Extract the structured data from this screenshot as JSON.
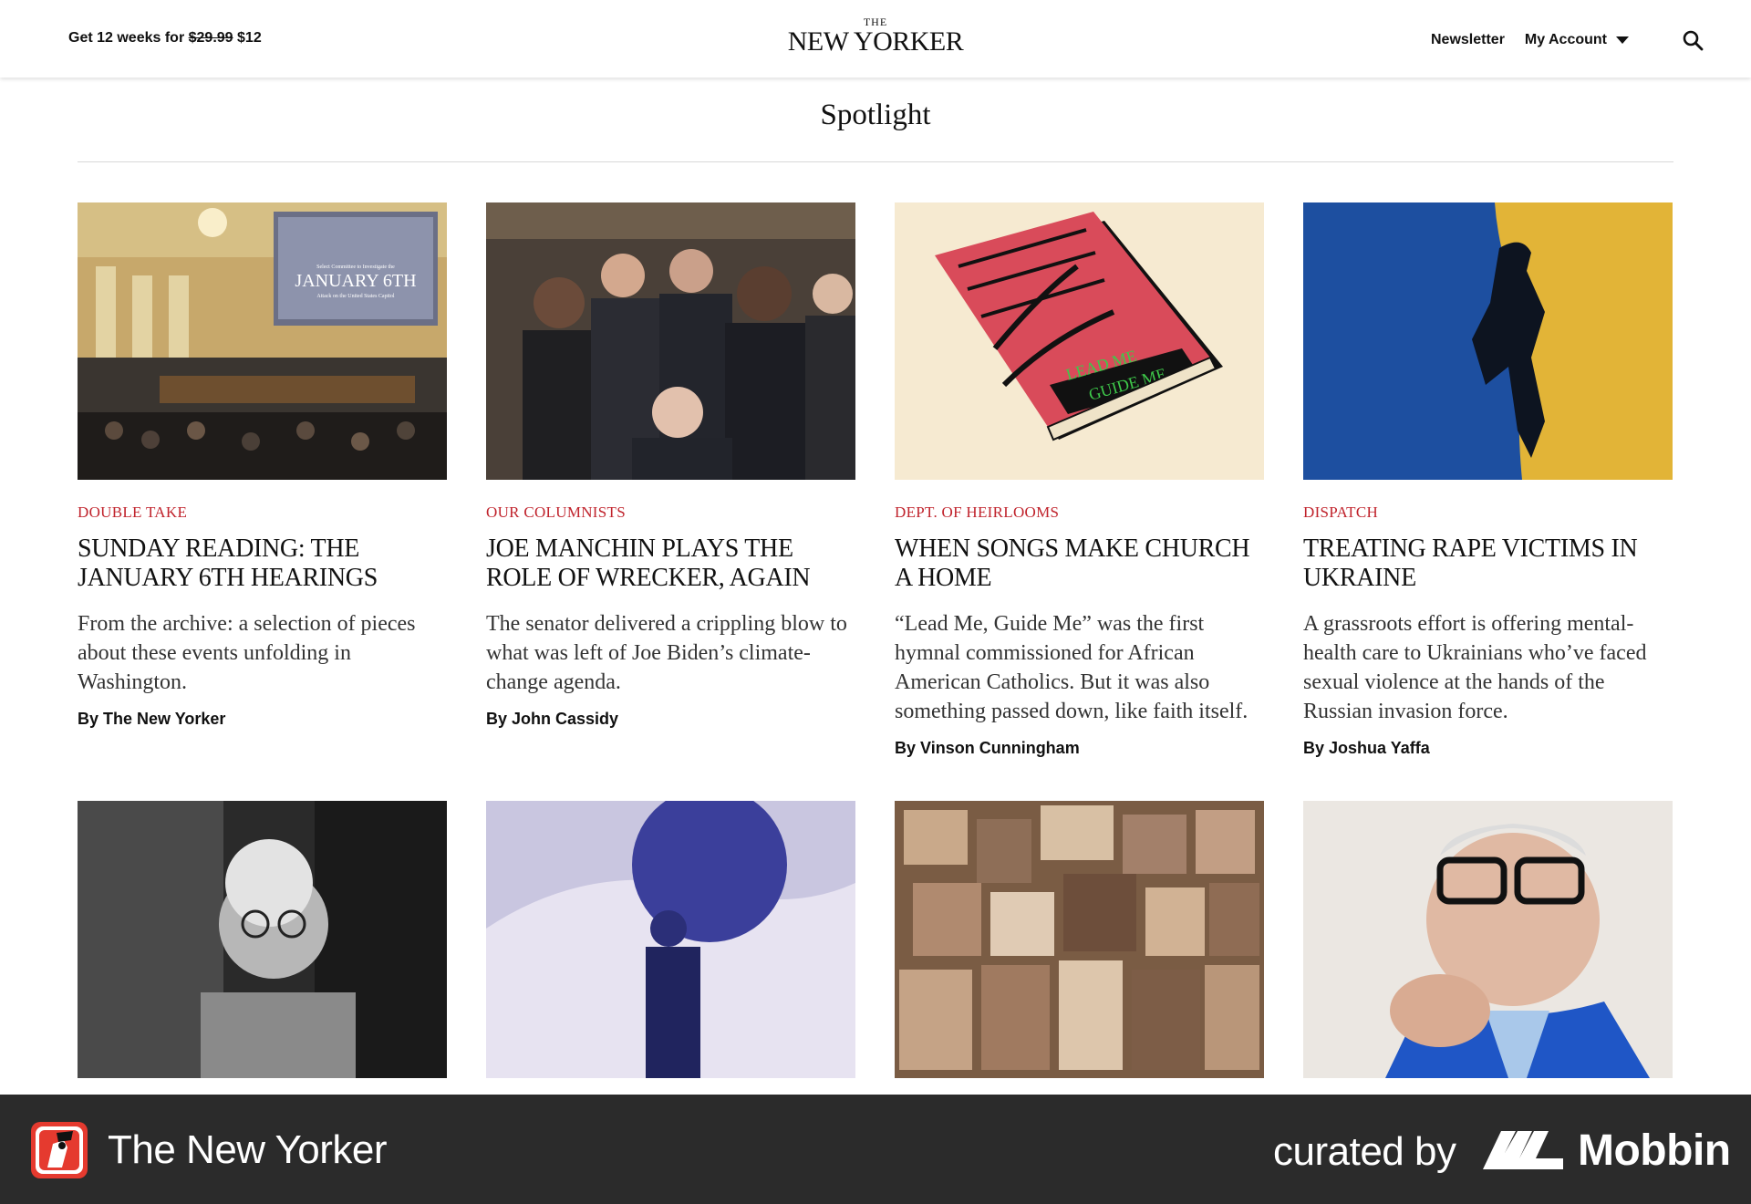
{
  "header": {
    "promo_prefix": "Get 12 weeks for",
    "promo_old_price": "$29.99",
    "promo_new_price": "$12",
    "logo_the": "THE",
    "logo_name": "NEW YORKER",
    "newsletter_label": "Newsletter",
    "account_label": "My Account"
  },
  "section": {
    "title": "Spotlight"
  },
  "articles": [
    {
      "rubric": "Double Take",
      "headline": "Sunday Reading: The January 6th Hearings",
      "dek": "From the archive: a selection of pieces about these events unfolding in Washington.",
      "byline_prefix": "By",
      "author": "The New Yorker",
      "image_text": {
        "line1": "Select Committee to Investigate the",
        "line2": "JANUARY 6TH",
        "line3": "Attack on the United States Capitol"
      }
    },
    {
      "rubric": "Our Columnists",
      "headline": "Joe Manchin Plays the Role of Wrecker, Again",
      "dek": "The senator delivered a crippling blow to what was left of Joe Biden’s climate-change agenda.",
      "byline_prefix": "By",
      "author": "John Cassidy"
    },
    {
      "rubric": "Dept. of Heirlooms",
      "headline": "When Songs Make Church a Home",
      "dek": "“Lead Me, Guide Me” was the first hymnal commissioned for African American Catholics. But it was also something passed down, like faith itself.",
      "byline_prefix": "By",
      "author": "Vinson Cunningham",
      "image_text": {
        "line1": "LEAD ME",
        "line2": "GUIDE ME"
      }
    },
    {
      "rubric": "Dispatch",
      "headline": "Treating Rape Victims in Ukraine",
      "dek": "A grassroots effort is offering mental-health care to Ukrainians who’ve faced sexual violence at the hands of the Russian invasion force.",
      "byline_prefix": "By",
      "author": "Joshua Yaffa"
    }
  ],
  "footer": {
    "brand": "The New Yorker",
    "curated_by": "curated by",
    "mobbin": "Mobbin"
  },
  "colors": {
    "rubric": "#c0232c",
    "footer_bg": "#2b2b2b",
    "text": "#111111"
  },
  "icons": [
    "search-icon",
    "caret-down-icon",
    "new-yorker-app-icon",
    "mobbin-logo-icon"
  ]
}
